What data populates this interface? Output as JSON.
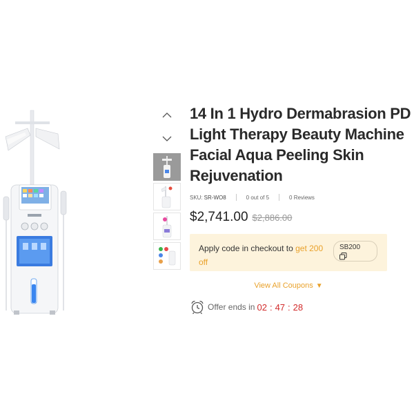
{
  "product": {
    "title_lines": [
      "14 In 1 Hydro Dermabrasion PD",
      "Light Therapy Beauty Machine",
      "Facial Aqua Peeling Skin",
      "Rejuvenation"
    ],
    "sku_label": "SKU:",
    "sku_value": "SR-WO8",
    "rating": "0 out of 5",
    "reviews": "0 Reviews",
    "price": "$2,741.00",
    "old_price": "$2,886.00"
  },
  "coupon": {
    "text_before": "Apply code in checkout to ",
    "highlight_a": "get 200",
    "highlight_b": "off",
    "code": "SB200",
    "view_all": "View All Coupons",
    "caret": "▼"
  },
  "offer": {
    "label": "Offer ends in",
    "hours": "02",
    "minutes": "47",
    "seconds": "28"
  },
  "icons": {
    "nav_up": "chevron-up-icon",
    "nav_down": "chevron-down-icon",
    "copy": "copy-icon",
    "clock": "alarm-clock-icon"
  },
  "colors": {
    "accent": "#e9a12a",
    "coupon_bg": "#fdf3dc",
    "timer": "#d22b2b",
    "screen_blue": "#3a7be0"
  }
}
